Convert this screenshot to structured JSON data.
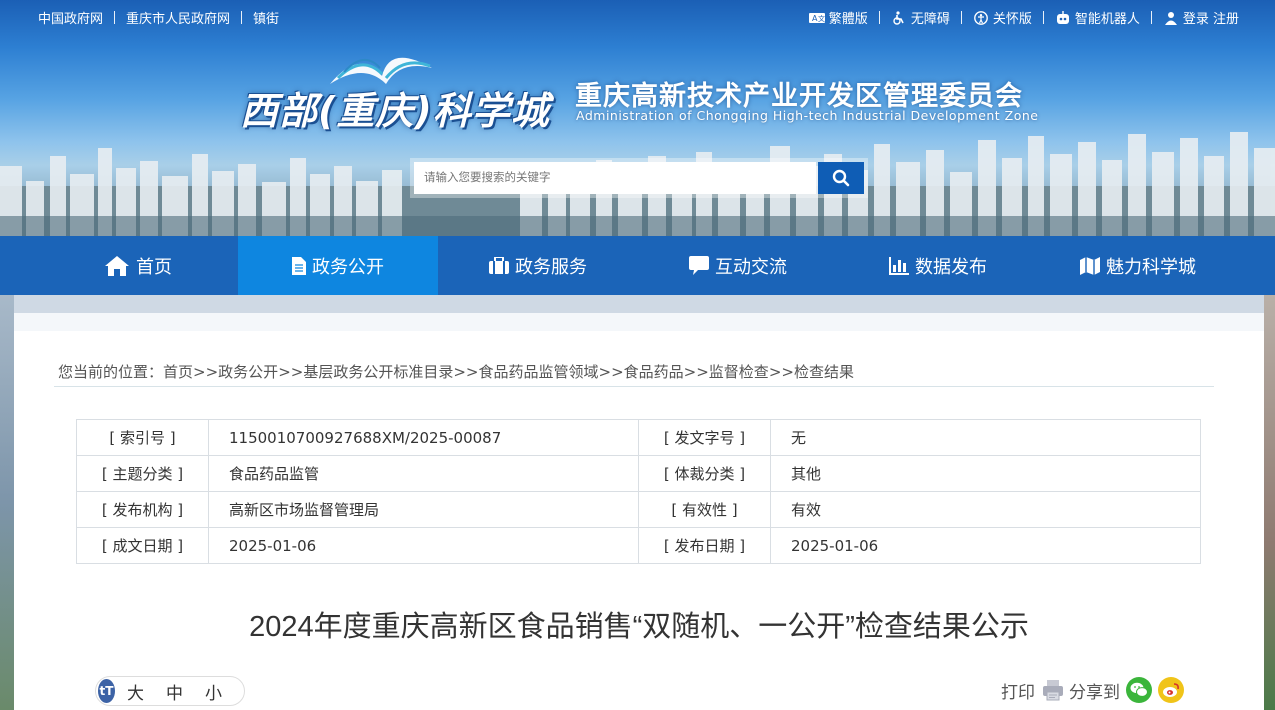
{
  "topbar": {
    "left_links": [
      "中国政府网",
      "重庆市人民政府网",
      "镇街"
    ],
    "right_links": [
      "繁體版",
      "无障碍",
      "关怀版",
      "智能机器人",
      "登录 注册"
    ]
  },
  "header": {
    "logo_main": "西部(重庆)科学城",
    "org_name_cn": "重庆高新技术产业开发区管理委员会",
    "org_name_en": "Administration of Chongqing High-tech Industrial Development Zone"
  },
  "search": {
    "placeholder": "请输入您要搜索的关键字"
  },
  "nav": {
    "items": [
      {
        "label": "首页",
        "icon": "home-icon",
        "active": false
      },
      {
        "label": "政务公开",
        "icon": "document-icon",
        "active": true
      },
      {
        "label": "政务服务",
        "icon": "briefcase-icon",
        "active": false
      },
      {
        "label": "互动交流",
        "icon": "chat-icon",
        "active": false
      },
      {
        "label": "数据发布",
        "icon": "bar-chart-icon",
        "active": false
      },
      {
        "label": "魅力科学城",
        "icon": "map-icon",
        "active": false
      }
    ]
  },
  "breadcrumb": {
    "prefix": "您当前的位置：",
    "items": [
      "首页",
      "政务公开",
      "基层政务公开标准目录",
      "食品药品监管领域",
      "食品药品",
      "监督检查",
      "检查结果"
    ],
    "separator": ">>"
  },
  "meta": {
    "rows": [
      {
        "k1": "[ 索引号 ]",
        "v1": "1150010700927688XM/2025-00087",
        "k2": "[ 发文字号 ]",
        "v2": "无"
      },
      {
        "k1": "[ 主题分类 ]",
        "v1": "食品药品监管",
        "k2": "[ 体裁分类 ]",
        "v2": "其他"
      },
      {
        "k1": "[ 发布机构 ]",
        "v1": "高新区市场监督管理局",
        "k2": "[ 有效性 ]",
        "v2": "有效"
      },
      {
        "k1": "[ 成文日期 ]",
        "v1": "2025-01-06",
        "k2": "[ 发布日期 ]",
        "v2": "2025-01-06"
      }
    ]
  },
  "article": {
    "title": "2024年度重庆高新区食品销售“双随机、一公开”检查结果公示"
  },
  "font_size": {
    "icon_text": "tT",
    "large": "大",
    "medium": "中",
    "small": "小"
  },
  "share": {
    "print_label": "打印",
    "share_label": "分享到"
  },
  "colors": {
    "nav_bg": "#1b64b8",
    "nav_active": "#0e86e0",
    "search_btn": "#0f5db5"
  }
}
